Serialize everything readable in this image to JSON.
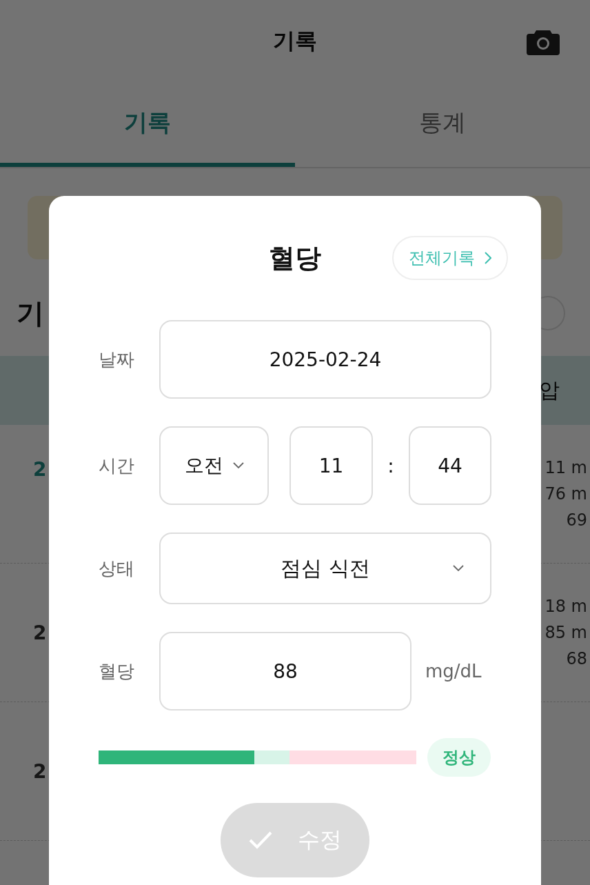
{
  "header": {
    "title": "기록"
  },
  "tabs": [
    {
      "label": "기록",
      "selected": true
    },
    {
      "label": "통계",
      "selected": false
    }
  ],
  "background": {
    "heading": "기",
    "table_header": "압",
    "rows": [
      {
        "date": "2",
        "selected": true,
        "values": [
          "11 m",
          "76 m",
          "69"
        ]
      },
      {
        "date": "2",
        "selected": false,
        "values": [
          "18 m",
          "85 m",
          "68"
        ]
      },
      {
        "date": "2",
        "selected": false
      }
    ]
  },
  "dialog": {
    "title": "혈당",
    "link": "전체기록",
    "fields": [
      {
        "label": "날짜",
        "kind": "date",
        "value": "2025-02-24"
      },
      {
        "label": "시간",
        "kind": "time",
        "period": "오전",
        "hour": "11",
        "separator": ":",
        "minute": "44"
      },
      {
        "label": "상태",
        "kind": "select",
        "value": "점심 식전"
      },
      {
        "label": "혈당",
        "kind": "number",
        "value": "88",
        "unit": "mg/dL"
      }
    ],
    "gauge": {
      "level": 0.49,
      "status": "정상",
      "color": "#2fb57a"
    },
    "submit": {
      "label": "수정",
      "disabled": true
    }
  }
}
